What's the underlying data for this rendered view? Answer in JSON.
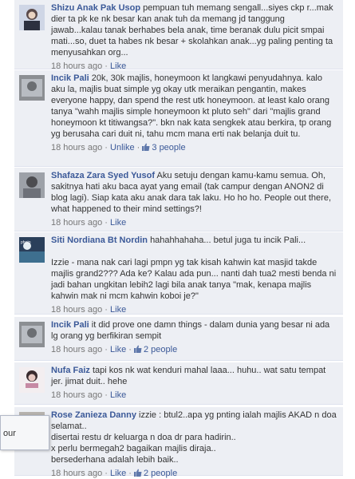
{
  "comments": [
    {
      "author": "Shizu Anak Pak Usop",
      "text": "pempuan tuh memang sengall...siyes ckp r...mak dier ta pk ke nk besar kan anak tuh da memang jd tanggung jawab...kalau tanak berhabes bela anak, time beranak dulu picit smpai mati...so, duet ta habes nk besar + skolahkan anak...yg paling penting ta menyusahkan org...",
      "time": "18 hours ago",
      "action": "Like"
    },
    {
      "author": "Incik Pali",
      "text": "20k, 30k majlis, honeymoon kt langkawi penyudahnya. kalo aku la, majlis buat simple yg okay utk meraikan pengantin, makes everyone happy, dan spend the rest utk honeymoon. at least kalo orang tanya \"wahh majlis simple honeymoon kt pluto seh\" dari \"majlis grand honeymoon kt titiwangsa?\". bkn nak kata sengkek atau berkira, tp orang yg berusaha cari duit ni, tahu mcm mana erti nak belanja duit tu.",
      "time": "18 hours ago",
      "action": "Unlike",
      "likes": "3 people"
    },
    {
      "author": "Shafaza Zara Syed Yusof",
      "text": "Aku setuju dengan kamu-kamu semua. Oh, sakitnya hati aku baca ayat yang email (tak campur dengan ANON2 di blog lagi). Siap kata aku anak dara tak laku. Ho ho ho. People out there, what happened to their mind settings?!",
      "time": "18 hours ago",
      "action": "Like"
    },
    {
      "author": "Siti Nordiana Bt Nordin",
      "text": "hahahhahaha... betul juga tu incik Pali...\n\nIzzie - mana nak cari lagi pmpn yg tak kisah kahwin kat masjid takde majlis grand2??? Ada ke? Kalau ada pun... nanti dah tua2 mesti benda ni jadi bahan ungkitan lebih2 lagi bila anak tanya \"mak, kenapa majlis kahwin mak ni mcm kahwin koboi je?\"",
      "time": "18 hours ago",
      "action": "Like"
    },
    {
      "author": "Incik Pali",
      "text": "it did prove one damn things - dalam dunia yang besar ni ada lg orang yg berfikiran sempit",
      "time": "18 hours ago",
      "action": "Like",
      "likes": "2 people"
    },
    {
      "author": "Nufa Faiz",
      "text": "tapi kos nk wat kenduri mahal laaa... huhu.. wat satu tempat jer. jimat duit.. hehe",
      "time": "18 hours ago",
      "action": "Like"
    },
    {
      "author": "Rose Zanieza Danny",
      "text": "izzie : btul2..apa yg pnting ialah majlis AKAD n doa selamat..\ndisertai restu dr keluarga n doa dr para hadirin..\nx perlu bermegah2 bagaikan majlis diraja..\nbersederhana adalah lebih baik..",
      "time": "18 hours ago",
      "action": "Like",
      "likes": "2 people"
    }
  ],
  "popup": {
    "text": "our"
  }
}
